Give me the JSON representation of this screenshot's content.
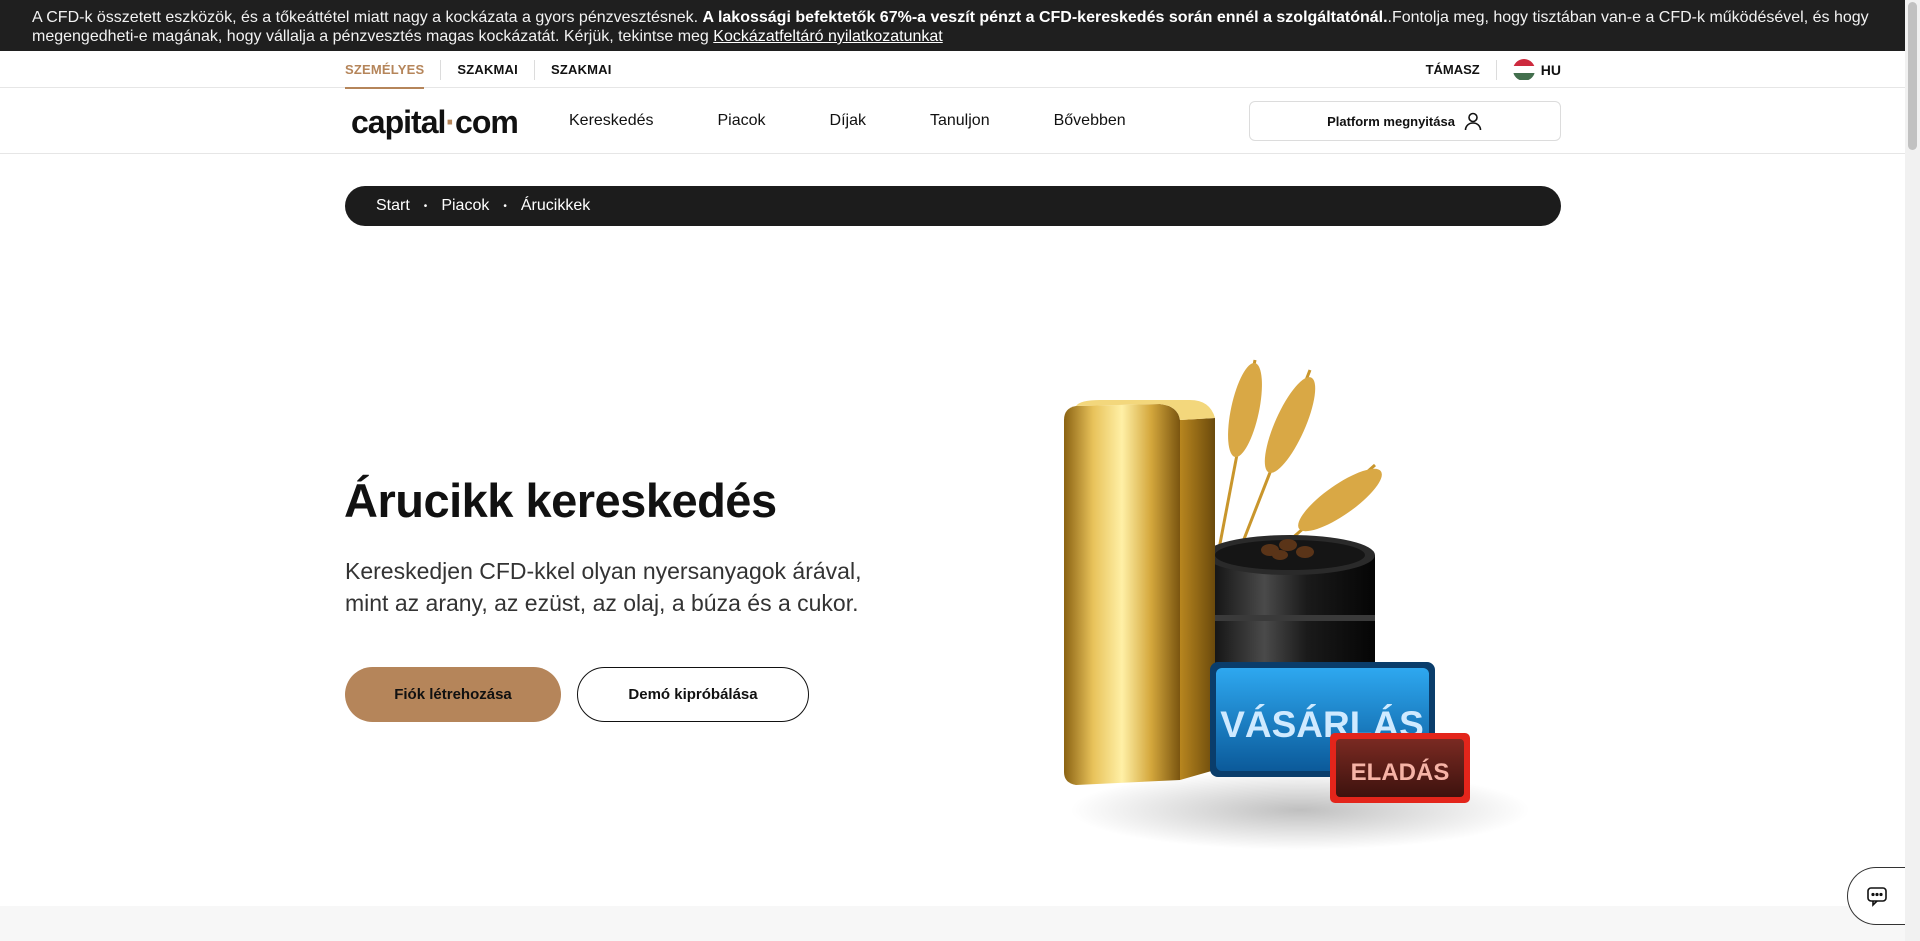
{
  "risk_banner": {
    "text_before": "A CFD-k összetett eszközök, és a tőkeáttétel miatt nagy a kockázata a gyors pénzvesztésnek. ",
    "text_bold": "A lakossági befektetők 67%-a veszít pénzt a CFD-kereskedés során ennél a szolgáltatónál.",
    "text_after": ".Fontolja meg, hogy tisztában van-e a CFD-k működésével, és hogy megengedheti-e magának, hogy vállalja a pénzvesztés magas kockázatát. Kérjük, tekintse meg ",
    "link_text": "Kockázatfeltáró nyilatkozatunkat"
  },
  "subnav": {
    "segments": [
      "SZEMÉLYES",
      "SZAKMAI",
      "SZAKMAI"
    ],
    "support": "TÁMASZ",
    "language": "HU"
  },
  "header": {
    "logo_left": "capital",
    "logo_dot": "·",
    "logo_right": "com",
    "nav": [
      "Kereskedés",
      "Piacok",
      "Díjak",
      "Tanuljon",
      "Bővebben"
    ],
    "platform_button": "Platform megnyitása"
  },
  "breadcrumb": [
    "Start",
    "Piacok",
    "Árucikkek"
  ],
  "breadcrumb_separator": "•",
  "hero": {
    "title": "Árucikk kereskedés",
    "subtitle": "Kereskedjen CFD-kkel olyan nyersanyagok árával, mint az arany, az ezüst, az olaj, a búza és a cukor.",
    "primary_button": "Fiók létrehozása",
    "secondary_button": "Demó kipróbálása",
    "buy_label": "VÁSÁRLÁS",
    "sell_label": "ELADÁS"
  },
  "colors": {
    "accent": "#b5855a",
    "dark": "#1c1c1c",
    "buy_blue": "#1f8fd6",
    "sell_red": "#c0392b"
  },
  "icons": {
    "user": "user-icon",
    "chat": "chat-icon",
    "flag": "hungary-flag-icon"
  }
}
